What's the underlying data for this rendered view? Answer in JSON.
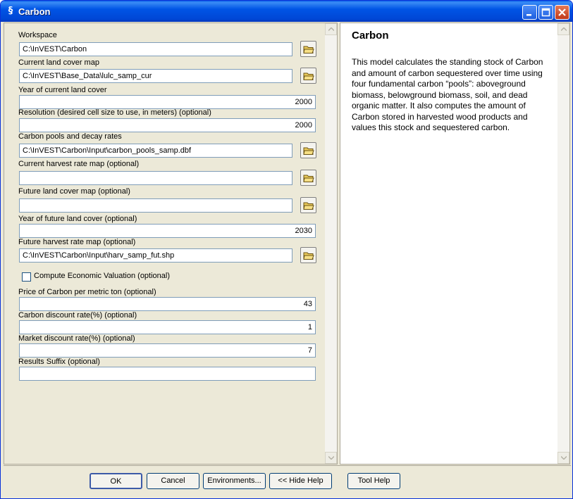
{
  "window": {
    "title": "Carbon",
    "icon": "gear-script-icon"
  },
  "form": {
    "workspace": {
      "label": "Workspace",
      "value": "C:\\InVEST\\Carbon"
    },
    "current_lulc": {
      "label": "Current land cover map",
      "value": "C:\\InVEST\\Base_Data\\lulc_samp_cur"
    },
    "year_current": {
      "label": "Year of current land cover",
      "value": "2000"
    },
    "resolution": {
      "label": "Resolution (desired cell size to use, in meters) (optional)",
      "value": "2000"
    },
    "carbon_pools": {
      "label": "Carbon pools and decay rates",
      "value": "C:\\InVEST\\Carbon\\Input\\carbon_pools_samp.dbf"
    },
    "current_harvest": {
      "label": "Current harvest rate map (optional)",
      "value": ""
    },
    "future_lulc": {
      "label": "Future land cover map (optional)",
      "value": ""
    },
    "year_future": {
      "label": "Year of future land cover (optional)",
      "value": "2030"
    },
    "future_harvest": {
      "label": "Future harvest rate map (optional)",
      "value": "C:\\InVEST\\Carbon\\Input\\harv_samp_fut.shp"
    },
    "compute_valuation": {
      "label": "Compute Economic Valuation (optional)",
      "checked": false
    },
    "carbon_price": {
      "label": "Price of Carbon per metric ton (optional)",
      "value": "43"
    },
    "carbon_discount": {
      "label": "Carbon discount rate(%) (optional)",
      "value": "1"
    },
    "market_discount": {
      "label": "Market discount rate(%) (optional)",
      "value": "7"
    },
    "results_suffix": {
      "label": "Results Suffix (optional)",
      "value": ""
    }
  },
  "help": {
    "title": "Carbon",
    "body": "This model calculates the standing stock of Carbon and amount of carbon sequestered over time using four fundamental carbon “pools”: aboveground biomass, belowground biomass, soil, and dead organic matter. It also computes the amount of Carbon stored in harvested wood products and values this stock and sequestered carbon."
  },
  "buttons": {
    "ok": "OK",
    "cancel": "Cancel",
    "environments": "Environments...",
    "hide_help": "<< Hide Help",
    "tool_help": "Tool Help"
  },
  "colors": {
    "titlebar": "#0055e5",
    "close_button": "#c0391a",
    "dialog_bg": "#ece9d8"
  }
}
